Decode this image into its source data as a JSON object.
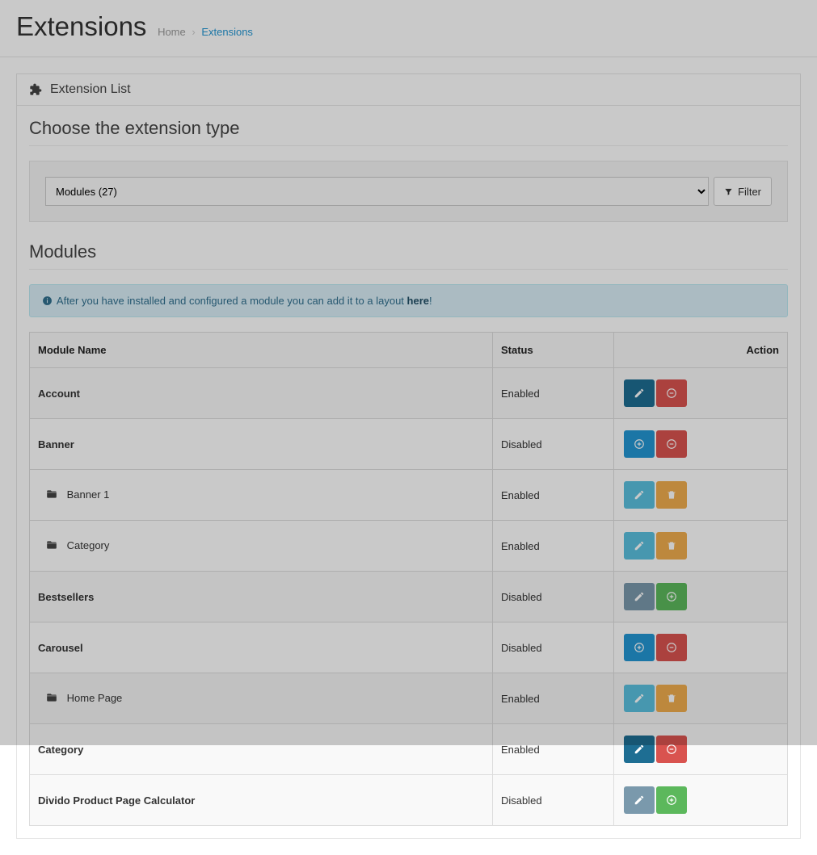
{
  "page": {
    "title": "Extensions",
    "breadcrumb": {
      "home": "Home",
      "current": "Extensions"
    }
  },
  "panel": {
    "heading": "Extension List"
  },
  "choose": {
    "title": "Choose the extension type",
    "select_value": "Modules (27)",
    "filter_label": "Filter"
  },
  "modules": {
    "title": "Modules",
    "alert_prefix": "After you have installed and configured a module you can add it to a layout ",
    "alert_link": "here",
    "alert_suffix": "!",
    "headers": {
      "name": "Module Name",
      "status": "Status",
      "action": "Action"
    },
    "rows": [
      {
        "kind": "parent",
        "name": "Account",
        "status": "Enabled",
        "actions": [
          "edit",
          "minus"
        ],
        "style": "dark"
      },
      {
        "kind": "parent",
        "name": "Banner",
        "status": "Disabled",
        "actions": [
          "add",
          "minus"
        ],
        "style": "light"
      },
      {
        "kind": "child",
        "name": "Banner 1",
        "status": "Enabled",
        "actions": [
          "edit-lt",
          "trash"
        ]
      },
      {
        "kind": "child",
        "name": "Category",
        "status": "Enabled",
        "actions": [
          "edit-lt",
          "trash"
        ]
      },
      {
        "kind": "parent",
        "name": "Bestsellers",
        "status": "Disabled",
        "actions": [
          "edit-dis",
          "add-green"
        ],
        "style": "mid"
      },
      {
        "kind": "parent",
        "name": "Carousel",
        "status": "Disabled",
        "actions": [
          "add",
          "minus"
        ],
        "style": "light"
      },
      {
        "kind": "child",
        "name": "Home Page",
        "status": "Enabled",
        "actions": [
          "edit-lt",
          "trash"
        ],
        "hover": true
      },
      {
        "kind": "parent",
        "name": "Category",
        "status": "Enabled",
        "actions": [
          "edit",
          "minus"
        ],
        "style": "dark"
      },
      {
        "kind": "parent",
        "name": "Divido Product Page Calculator",
        "status": "Disabled",
        "actions": [
          "edit-dis",
          "add-green"
        ],
        "style": "mid"
      }
    ]
  }
}
